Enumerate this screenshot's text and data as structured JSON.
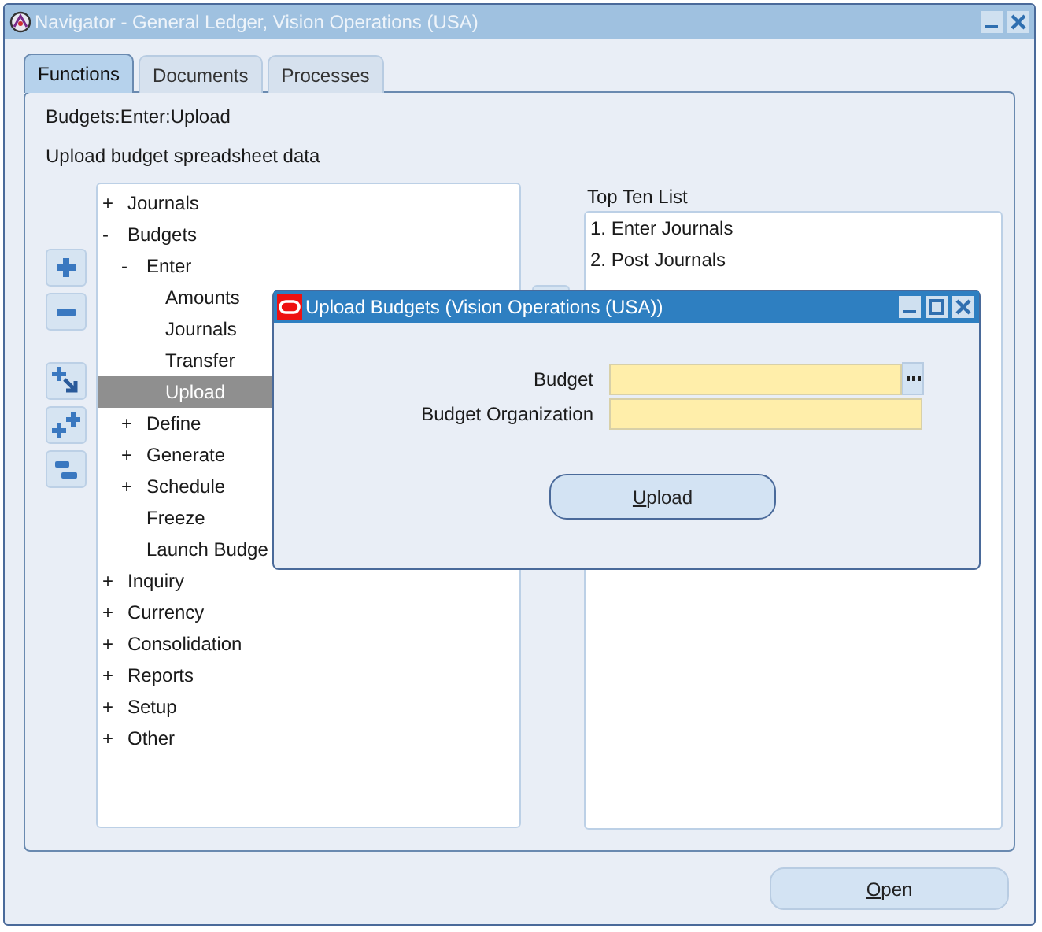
{
  "window": {
    "title": "Navigator - General Ledger, Vision Operations (USA)"
  },
  "tabs": [
    {
      "label": "Functions",
      "selected": true
    },
    {
      "label": "Documents",
      "selected": false
    },
    {
      "label": "Processes",
      "selected": false
    }
  ],
  "path": "Budgets:Enter:Upload",
  "description": "Upload budget spreadsheet data",
  "tree": [
    {
      "sign": "+",
      "label": "Journals",
      "selected": false
    },
    {
      "sign": "-",
      "label": "Budgets",
      "selected": false,
      "children": [
        {
          "sign": "-",
          "label": "Enter",
          "selected": false,
          "children": [
            {
              "label": "Amounts",
              "selected": false
            },
            {
              "label": "Journals",
              "selected": false
            },
            {
              "label": "Transfer",
              "selected": false
            },
            {
              "label": "Upload",
              "selected": true
            }
          ]
        },
        {
          "sign": "+",
          "label": "Define",
          "selected": false
        },
        {
          "sign": "+",
          "label": "Generate",
          "selected": false
        },
        {
          "sign": "+",
          "label": "Schedule",
          "selected": false
        },
        {
          "label": "Freeze",
          "selected": false
        },
        {
          "label": "Launch Budge",
          "selected": false
        }
      ]
    },
    {
      "sign": "+",
      "label": "Inquiry",
      "selected": false
    },
    {
      "sign": "+",
      "label": "Currency",
      "selected": false
    },
    {
      "sign": "+",
      "label": "Consolidation",
      "selected": false
    },
    {
      "sign": "+",
      "label": "Reports",
      "selected": false
    },
    {
      "sign": "+",
      "label": "Setup",
      "selected": false
    },
    {
      "sign": "+",
      "label": "Other",
      "selected": false
    }
  ],
  "top_ten": {
    "label": "Top Ten List",
    "items": [
      "1. Enter Journals",
      "2. Post Journals"
    ]
  },
  "open_button": {
    "label": "Open"
  },
  "dialog": {
    "title": "Upload Budgets (Vision Operations (USA))",
    "fields": [
      {
        "label": "Budget",
        "kind": "lov"
      },
      {
        "label": "Budget Organization",
        "kind": "text"
      }
    ],
    "button": {
      "label": "Upload"
    }
  }
}
